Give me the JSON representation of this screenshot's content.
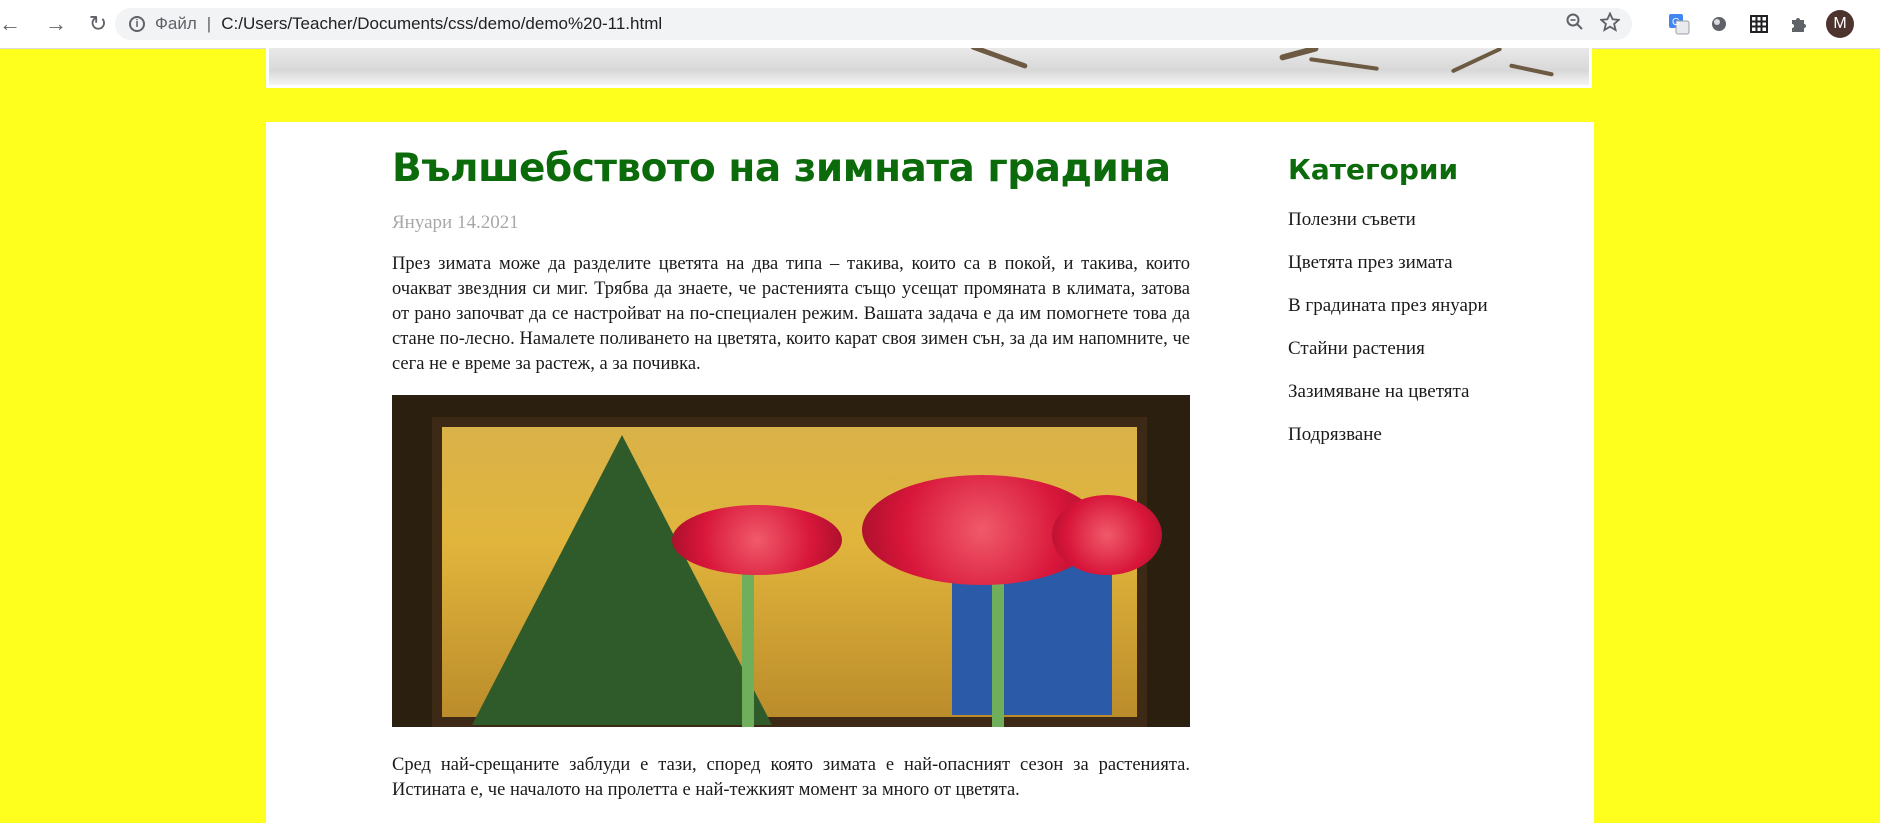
{
  "browser": {
    "scheme_label": "Файл",
    "url": "C:/Users/Teacher/Documents/css/demo/demo%20-11.html",
    "avatar_initial": "M"
  },
  "article": {
    "title": "Вълшебството на зимната градина",
    "date": "Януари 14.2021",
    "paragraph1": "През зимата може да разделите цветята на два типа – такива, които са в покой, и такива, които очакват звездния си миг. Трябва да знаете, че растенията също усещат промяната в климата, затова от рано започват да се настройват на по-специален режим. Вашата задача е да им помогнете това да стане по-лесно. Намалете поливането на цветята, които карат своя зимен сън, за да им напомните, че сега не е време за растеж, а за почивка.",
    "paragraph2": "Сред най-срещаните заблуди е тази, според която зимата е най-опасният сезон за растенията. Истината е, че началото на пролетта е най-тежкият момент за много от цветята."
  },
  "sidebar": {
    "heading": "Категории",
    "items": [
      "Полезни съвети",
      "Цветята през зимата",
      "В градината през януари",
      "Стайни растения",
      "Зазимяване на цветята",
      "Подрязване"
    ]
  },
  "colors": {
    "page_background": "#ffff1e",
    "heading_green": "#0b6b0b"
  }
}
